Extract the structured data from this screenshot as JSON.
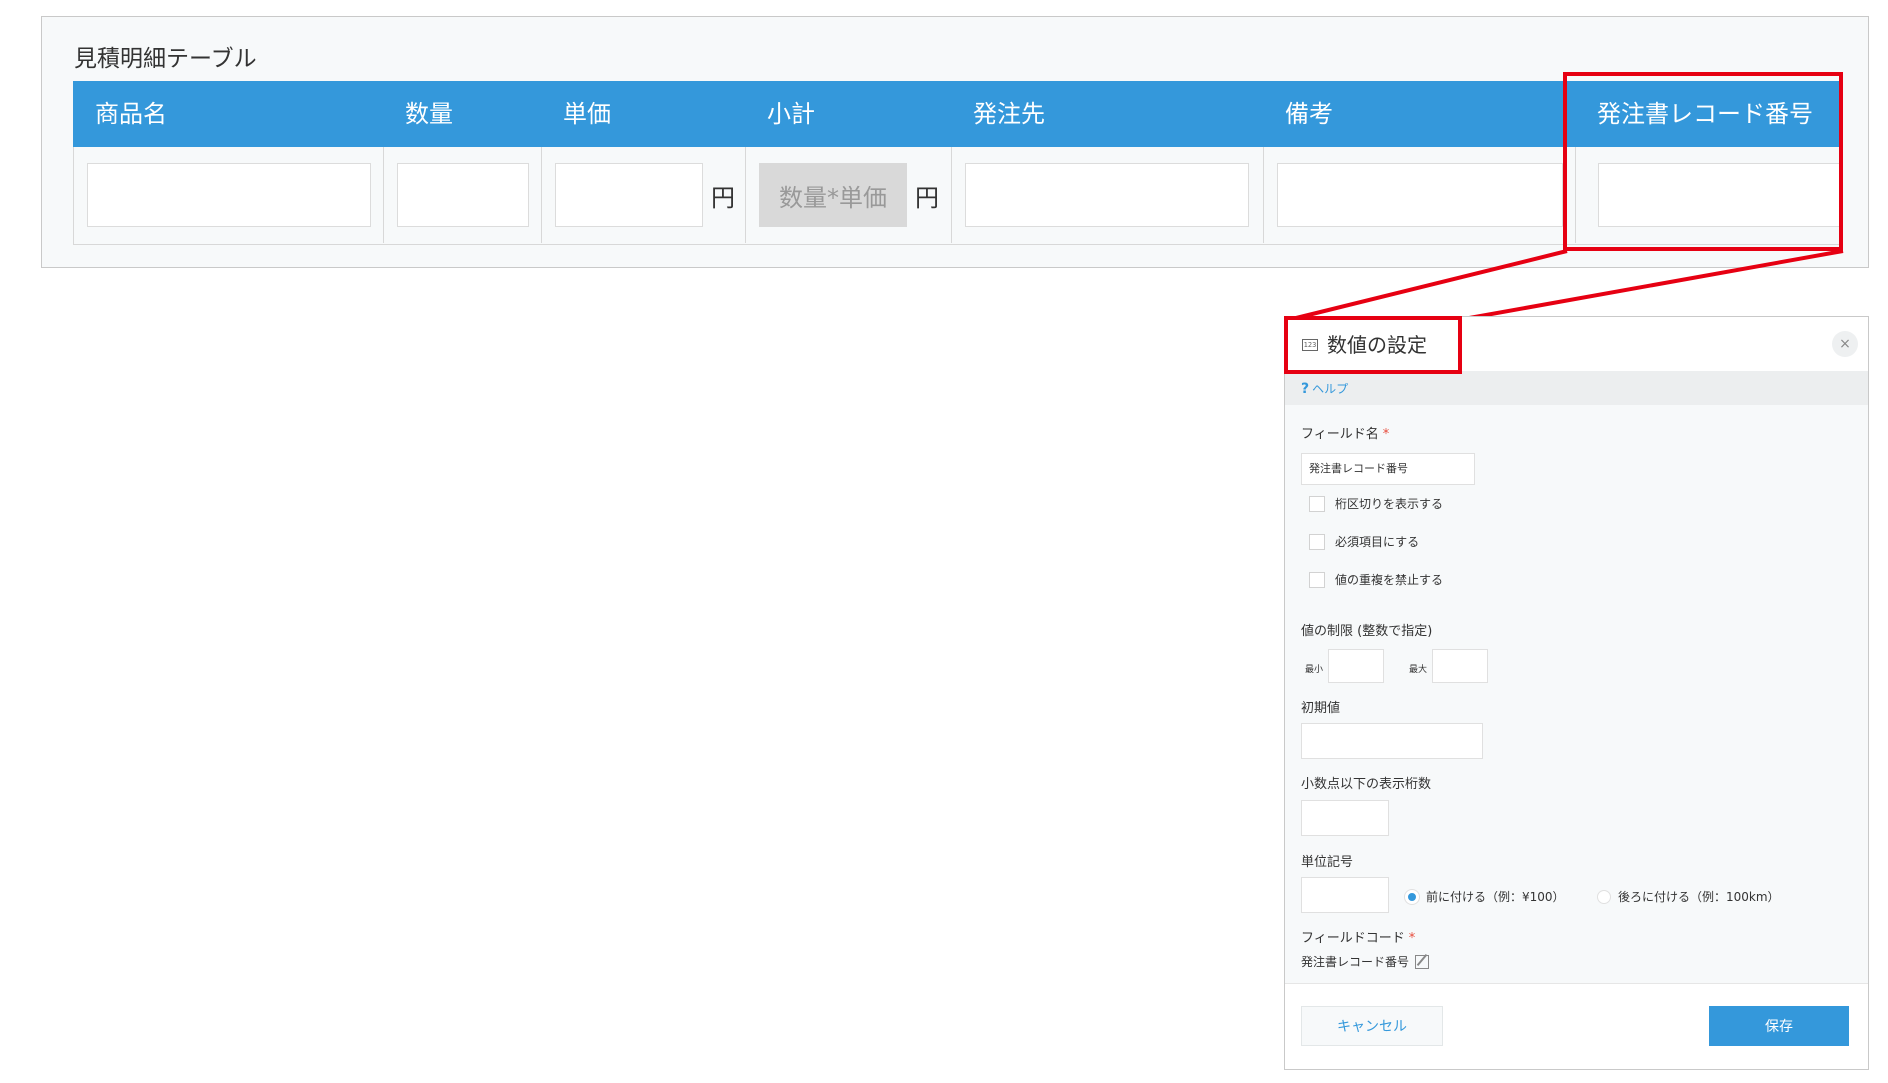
{
  "table": {
    "title": "見積明細テーブル",
    "columns": [
      "商品名",
      "数量",
      "単価",
      "小計",
      "発注先",
      "備考",
      "発注書レコード番号"
    ],
    "currency_unit": "円",
    "subtotal_placeholder": "数量*単価",
    "header_color": "#3498db"
  },
  "dialog": {
    "title": "数値の設定",
    "icon": "number-field-icon",
    "icon_text": "123",
    "close_symbol": "×",
    "help_symbol": "?",
    "help_label": "ヘルプ",
    "field_name_label": "フィールド名",
    "required_mark": "*",
    "field_name_value": "発注書レコード番号",
    "options": [
      {
        "label": "桁区切りを表示する",
        "checked": false
      },
      {
        "label": "必須項目にする",
        "checked": false
      },
      {
        "label": "値の重複を禁止する",
        "checked": false
      }
    ],
    "value_limit_label": "値の制限 (整数で指定)",
    "min_label": "最小",
    "max_label": "最大",
    "initial_value_label": "初期値",
    "decimal_digits_label": "小数点以下の表示桁数",
    "unit_symbol_label": "単位記号",
    "unit_position_options": [
      {
        "label": "前に付ける（例：¥100）",
        "selected": true
      },
      {
        "label": "後ろに付ける（例：100km）",
        "selected": false
      }
    ],
    "field_code_label": "フィールドコード",
    "field_code_value": "発注書レコード番号",
    "cancel_label": "キャンセル",
    "save_label": "保存",
    "accent_color": "#3498db",
    "highlight_color": "#e60012"
  }
}
